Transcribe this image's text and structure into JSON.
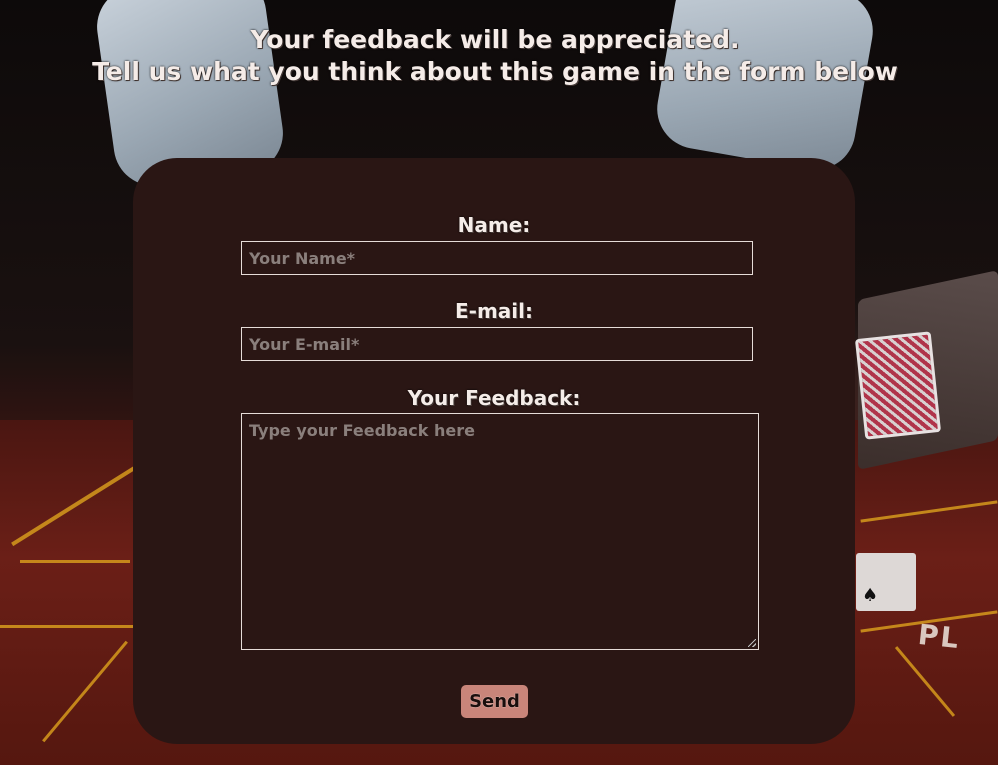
{
  "header": {
    "line1": "Your feedback will be appreciated.",
    "line2": "Tell us what you think about this game in the form below"
  },
  "form": {
    "name": {
      "label": "Name:",
      "placeholder": "Your Name*"
    },
    "email": {
      "label": "E-mail:",
      "placeholder": "Your E-mail*"
    },
    "feedback": {
      "label": "Your Feedback:",
      "placeholder": "Type your Feedback here"
    },
    "send_label": "Send"
  },
  "background": {
    "table_text": "PL"
  },
  "colors": {
    "panel": "#2a1614",
    "button": "#c9857a",
    "text": "#f5ece8"
  }
}
